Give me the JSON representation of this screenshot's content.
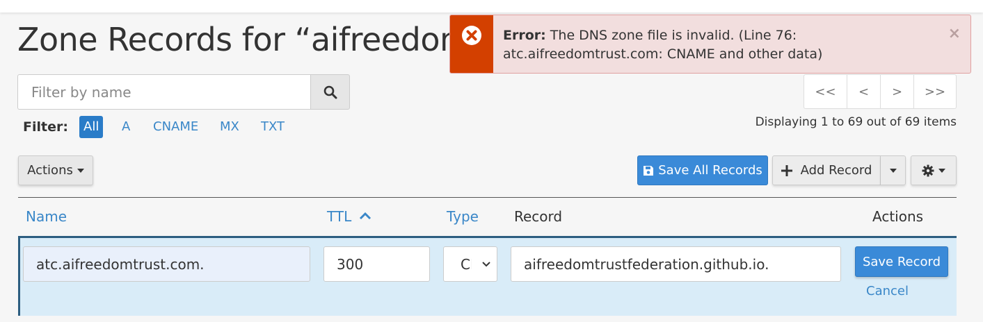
{
  "page": {
    "title": "Zone Records for “aifreedomtrust.com”"
  },
  "search": {
    "placeholder": "Filter by name",
    "value": ""
  },
  "filter": {
    "label": "Filter:",
    "items": [
      "All",
      "A",
      "CNAME",
      "MX",
      "TXT"
    ],
    "active": "All"
  },
  "pagination": {
    "first": "<<",
    "prev": "<",
    "next": ">",
    "last": ">>",
    "summary": "Displaying 1 to 69 out of 69 items"
  },
  "toolbar": {
    "actions_label": "Actions",
    "save_all_label": "Save All Records",
    "add_record_label": "Add Record"
  },
  "table": {
    "headers": {
      "name": "Name",
      "ttl": "TTL",
      "type": "Type",
      "record": "Record",
      "actions": "Actions"
    },
    "edit_row": {
      "name": "atc.aifreedomtrust.com.",
      "ttl": "300",
      "type": "CNAME",
      "record": "aifreedomtrustfederation.github.io.",
      "save_label": "Save Record",
      "cancel_label": "Cancel"
    }
  },
  "alert": {
    "strong": "Error:",
    "message": "The DNS zone file is invalid. (Line 76: atc.aifreedomtrust.com: CNAME and other data)",
    "close": "×"
  },
  "colors": {
    "primary": "#3a8ad8",
    "link": "#3a87c8",
    "alert_icon_bg": "#d34000",
    "alert_bg": "#f2dede",
    "row_highlight": "#d9ecf8"
  }
}
